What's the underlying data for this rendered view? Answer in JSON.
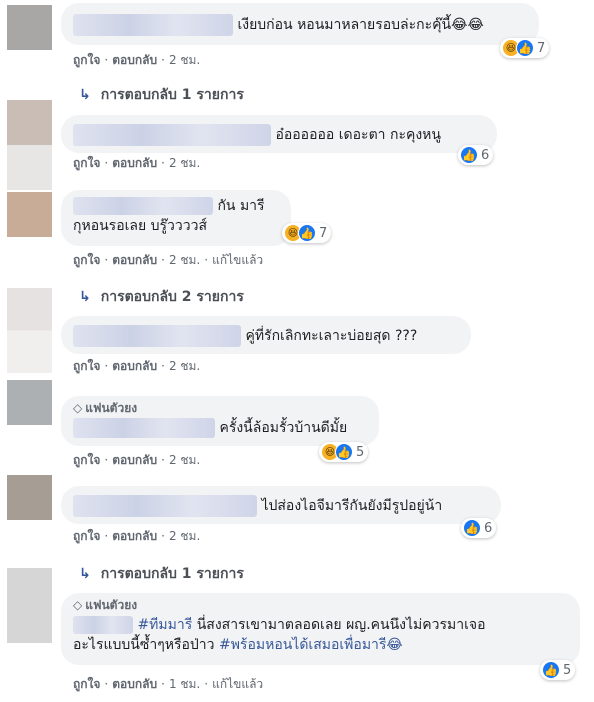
{
  "action_labels": {
    "like": "ถูกใจ",
    "reply": "ตอบกลับ",
    "edited": "แก้ไขแล้ว"
  },
  "comments": [
    {
      "text": "เงียบก่อน หอนมาหลายรอบล่ะกะคุ๊นี้😂😂",
      "time": "2 ชม.",
      "reaction_count": "7"
    },
    {
      "text": "อ๋ออออออ เดอะตา กะคุงหนู",
      "time": "2 ชม.",
      "reaction_count": "6"
    },
    {
      "text": "กัน มารี",
      "text2": "กุหอนรอเลย บรู๊ววววส์",
      "time": "2 ชม.",
      "reaction_count": "7"
    },
    {
      "text": "คู่ที่รักเลิกทะเลาะบ่อยสุด ???",
      "time": "2 ชม."
    },
    {
      "badge": "แฟนตัวยง",
      "text": "ครั้งนี้ล้อมรั้วบ้านดีมั้ย",
      "time": "2 ชม.",
      "reaction_count": "5"
    },
    {
      "text": "ไปส่องไอจีมารีกันยังมีรูปอยู่น้า",
      "time": "2 ชม.",
      "reaction_count": "6"
    },
    {
      "badge": "แฟนตัวยง",
      "tag1": "#ทีมมารี",
      "text": " นี่สงสารเขามาตลอดเลย ผญ.คนนึงไม่ควรมาเจอ",
      "text2": "อะไรแบบนี้ซ้ำๆหรือป่าว ",
      "tag2": "#พร้อมหอนได้เสมอเพื่อมารี😂",
      "time": "1 ชม.",
      "reaction_count": "5"
    }
  ],
  "replies": [
    {
      "label": "การตอบกลับ 1 รายการ"
    },
    {
      "label": "การตอบกลับ 2 รายการ"
    },
    {
      "label": "การตอบกลับ 1 รายการ"
    }
  ],
  "colors": {
    "link": "#385898",
    "bubble": "#f2f3f5",
    "like_blue": "#1877f2",
    "haha_yellow": "#f7b125"
  }
}
